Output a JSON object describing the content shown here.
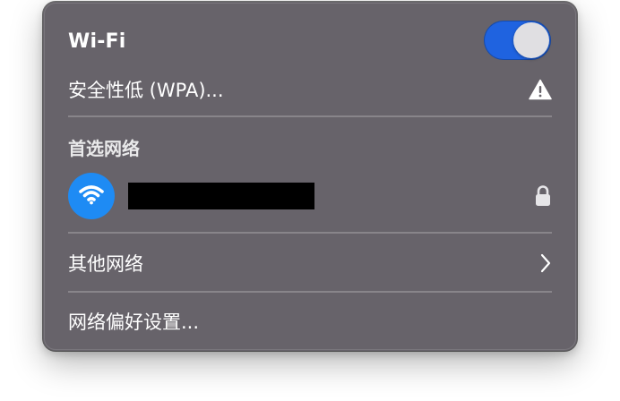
{
  "wifi": {
    "title": "Wi-Fi",
    "enabled": true
  },
  "security": {
    "label": "安全性低 (WPA)...",
    "icon": "warning-icon"
  },
  "preferred": {
    "heading": "首选网络",
    "network": {
      "name_redacted": true,
      "icon": "wifi-icon",
      "lock_icon": "lock-icon"
    }
  },
  "other_networks": {
    "label": "其他网络",
    "icon": "chevron-right-icon"
  },
  "preferences": {
    "label": "网络偏好设置..."
  },
  "colors": {
    "panel": "#67636a",
    "toggle_on": "#1f63e0",
    "wifi_badge": "#1e8bf4",
    "text": "#ffffff"
  }
}
